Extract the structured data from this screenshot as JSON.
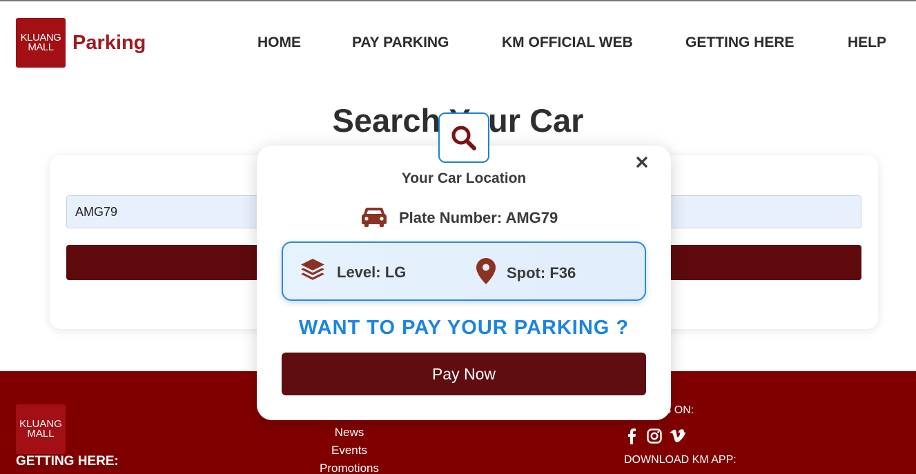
{
  "header": {
    "logo_line1": "KLUANG",
    "logo_line2": "MALL",
    "brand": "Parking",
    "nav": [
      {
        "label": "HOME"
      },
      {
        "label": "PAY PARKING"
      },
      {
        "label": "KM OFFICIAL WEB"
      },
      {
        "label": "GETTING HERE"
      },
      {
        "label": "HELP"
      }
    ]
  },
  "main": {
    "title": "Search Your Car",
    "plate_input_value": "AMG79"
  },
  "modal": {
    "title": "Your Car Location",
    "plate_label": "Plate Number: AMG79",
    "level_label": "Level: LG",
    "spot_label": "Spot: F36",
    "pay_question": "WANT TO PAY YOUR PARKING ?",
    "pay_button": "Pay Now",
    "icons": [
      "search-icon",
      "close-icon",
      "car-icon",
      "layers-icon",
      "map-pin-icon"
    ]
  },
  "footer": {
    "logo_line1": "KLUANG",
    "logo_line2": "MALL",
    "getting_here": "GETTING HERE:",
    "links": [
      "News",
      "Events",
      "Promotions"
    ],
    "follow_label": "V US ON:",
    "download_label": "DOWNLOAD KM APP:",
    "socials": [
      "facebook-icon",
      "instagram-icon",
      "vimeo-icon"
    ]
  },
  "colors": {
    "brand_red": "#9e1b1f",
    "footer_bg": "#800000",
    "button_dark": "#5e0a0c",
    "accent_blue": "#1a84e4"
  }
}
